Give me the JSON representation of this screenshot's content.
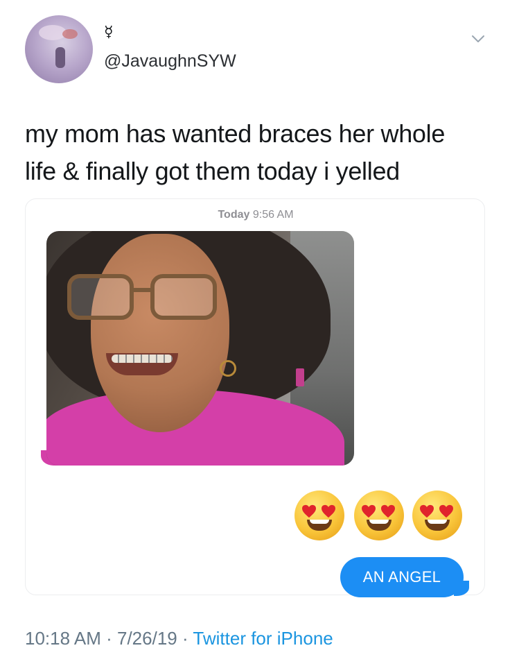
{
  "author": {
    "display_name": "☿",
    "handle": "@JavaughnSYW"
  },
  "tweet": {
    "text_line1": "my mom has wanted braces her whole",
    "text_line2": "life & finally got them today i yelled"
  },
  "screenshot": {
    "timestamp_day": "Today",
    "timestamp_time": "9:56 AM",
    "emoji_names": [
      "heart-eyes-emoji",
      "heart-eyes-emoji",
      "heart-eyes-emoji"
    ],
    "reply_bubble": "AN ANGEL",
    "reply_bubble_color": "#1c8ef4"
  },
  "footer": {
    "time": "10:18 AM",
    "separator": "·",
    "date": "7/26/19",
    "source": "Twitter for iPhone",
    "source_color": "#1b95e0"
  }
}
